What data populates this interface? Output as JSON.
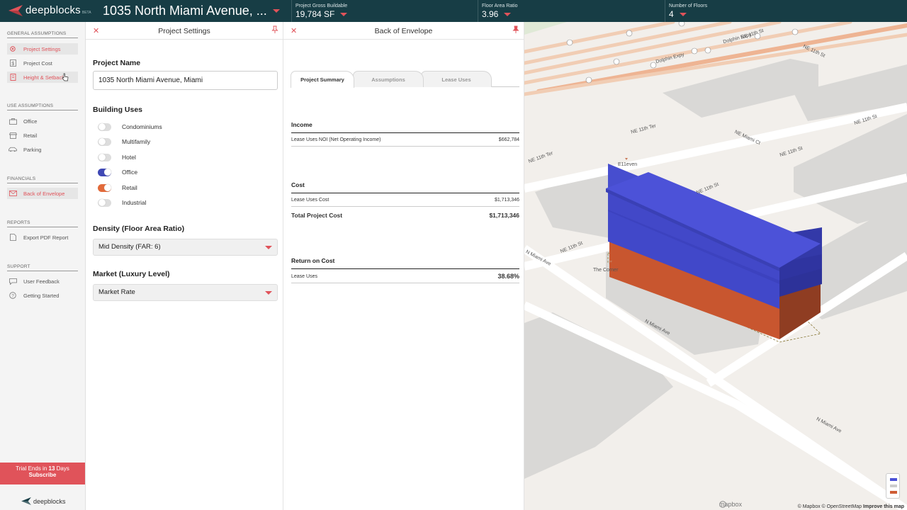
{
  "app": {
    "logo_text": "deepblocks",
    "logo_badge": "BETA",
    "address": "1035 North Miami Avenue, ..."
  },
  "metrics": [
    {
      "label": "Project Gross Buildable",
      "value": "19,784 SF"
    },
    {
      "label": "Floor Area Ratio",
      "value": "3.96"
    },
    {
      "label": "Number of Floors",
      "value": "4"
    }
  ],
  "sidebar": {
    "sections": {
      "general": "GENERAL ASSUMPTIONS",
      "use": "USE ASSUMPTIONS",
      "financials": "FINANCIALS",
      "reports": "REPORTS",
      "support": "SUPPORT"
    },
    "items": {
      "project_settings": "Project Settings",
      "project_cost": "Project Cost",
      "height_setbacks": "Height & Setbacks",
      "office": "Office",
      "retail": "Retail",
      "parking": "Parking",
      "back_of_envelope": "Back of Envelope",
      "export_pdf": "Export PDF Report",
      "user_feedback": "User Feedback",
      "getting_started": "Getting Started"
    },
    "trial_prefix": "Trial Ends in",
    "trial_days": "13",
    "trial_suffix": "Days",
    "subscribe": "Subscribe",
    "footer_logo": "deepblocks"
  },
  "project_settings": {
    "title": "Project Settings",
    "project_name_label": "Project Name",
    "project_name_value": "1035 North Miami Avenue, Miami",
    "building_uses_label": "Building Uses",
    "uses": [
      {
        "label": "Condominiums",
        "on": false,
        "color": "#dddddd"
      },
      {
        "label": "Multifamily",
        "on": false,
        "color": "#dddddd"
      },
      {
        "label": "Hotel",
        "on": false,
        "color": "#dddddd"
      },
      {
        "label": "Office",
        "on": true,
        "color": "#3f48b5"
      },
      {
        "label": "Retail",
        "on": true,
        "color": "#e26a3a"
      },
      {
        "label": "Industrial",
        "on": false,
        "color": "#dddddd"
      }
    ],
    "density_label": "Density (Floor Area Ratio)",
    "density_value": "Mid Density (FAR: 6)",
    "market_label": "Market (Luxury Level)",
    "market_value": "Market Rate"
  },
  "back_of_envelope": {
    "title": "Back of Envelope",
    "tabs": [
      "Project Summary",
      "Assumptions",
      "Lease Uses"
    ],
    "income_title": "Income",
    "income_rows": [
      {
        "label": "Lease Uses NOI (Net Operating Income)",
        "value": "$662,784"
      }
    ],
    "cost_title": "Cost",
    "cost_rows": [
      {
        "label": "Lease Uses Cost",
        "value": "$1,713,346"
      }
    ],
    "total_label": "Total Project Cost",
    "total_value": "$1,713,346",
    "roc_title": "Return on Cost",
    "roc_rows": [
      {
        "label": "Lease Uses",
        "value": "38.68%"
      }
    ]
  },
  "map": {
    "labels": {
      "ne11ter_a": "NE 11th Ter",
      "ne11ter_b": "NE 11th Ter",
      "ne_miami_ct": "NE Miami Ct",
      "ne11st_a": "NE 11th St",
      "ne11st_b": "NE 11th St",
      "ne11st_c": "NE 11th St",
      "ne11st_d": "NE 11th St",
      "ne11st_e": "NE 11th St",
      "ne11st_f": "NE 11th St",
      "dolphin_a": "Dolphin Expy",
      "dolphin_b": "Dolphin Expy",
      "n_miami_a": "N Miami Ave",
      "n_miami_b": "N Miami Ave",
      "n_miami_c": "N Miami Ave",
      "elleven": "E11even",
      "the_corner": "The Corner"
    },
    "mapbox": "mapbox",
    "attribution_1": "© Mapbox © OpenStreetMap",
    "attribution_2": "Improve this map",
    "colors": {
      "office": "#4a50d6",
      "retail": "#cf5d35"
    }
  }
}
